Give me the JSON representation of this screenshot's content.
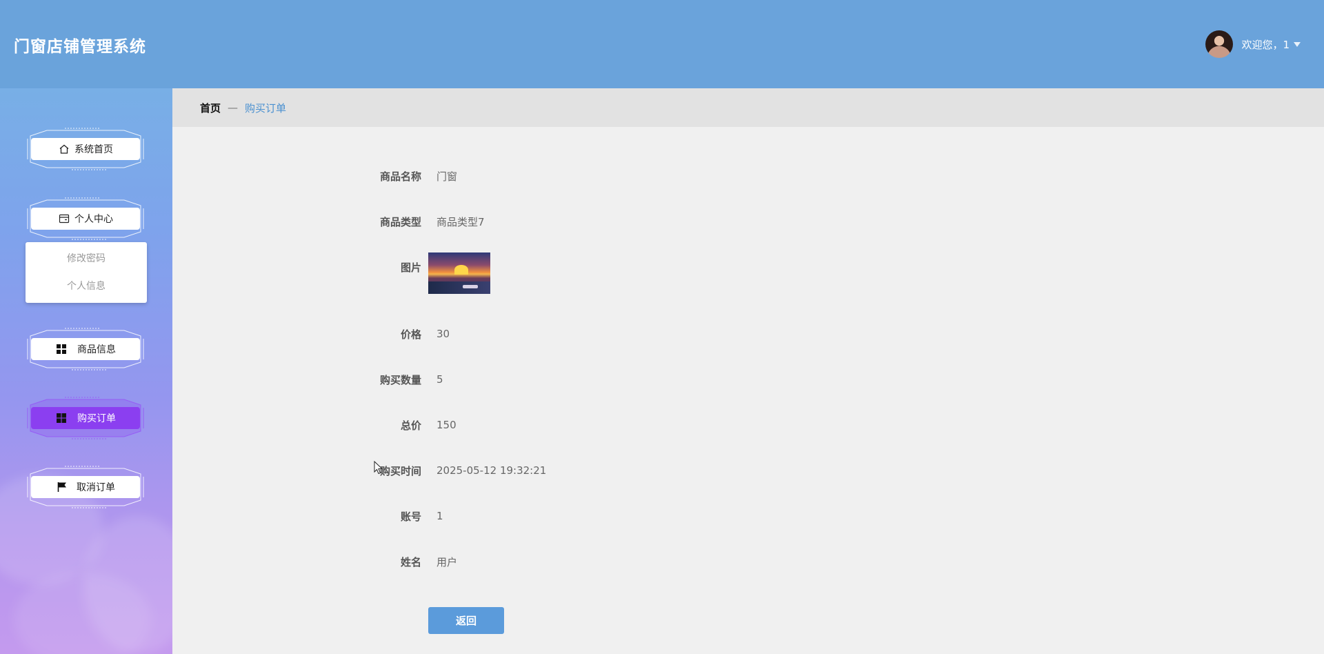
{
  "header": {
    "app_title": "门窗店铺管理系统",
    "welcome": "欢迎您，1"
  },
  "sidebar": {
    "items": [
      {
        "label": "系统首页",
        "icon": "home-icon"
      },
      {
        "label": "个人中心",
        "icon": "wallet-icon"
      },
      {
        "label": "商品信息",
        "icon": "grid-icon"
      },
      {
        "label": "购买订单",
        "icon": "grid-icon",
        "active": true
      },
      {
        "label": "取消订单",
        "icon": "flag-icon"
      }
    ],
    "submenu": [
      "修改密码",
      "个人信息"
    ],
    "active_color": "#8b3ff0"
  },
  "breadcrumb": {
    "home": "首页",
    "separator": "—",
    "current": "购买订单"
  },
  "detail": {
    "fields": [
      {
        "label": "商品名称",
        "value": "门窗"
      },
      {
        "label": "商品类型",
        "value": "商品类型7"
      },
      {
        "label": "图片",
        "value": ""
      },
      {
        "label": "价格",
        "value": "30"
      },
      {
        "label": "购买数量",
        "value": "5"
      },
      {
        "label": "总价",
        "value": "150"
      },
      {
        "label": "购买时间",
        "value": "2025-05-12 19:32:21"
      },
      {
        "label": "账号",
        "value": "1"
      },
      {
        "label": "姓名",
        "value": "用户"
      }
    ],
    "back_label": "返回"
  },
  "colors": {
    "header": "#6aa3db",
    "accent": "#5b9bdb",
    "breadcrumb_current": "#4a90d0"
  }
}
